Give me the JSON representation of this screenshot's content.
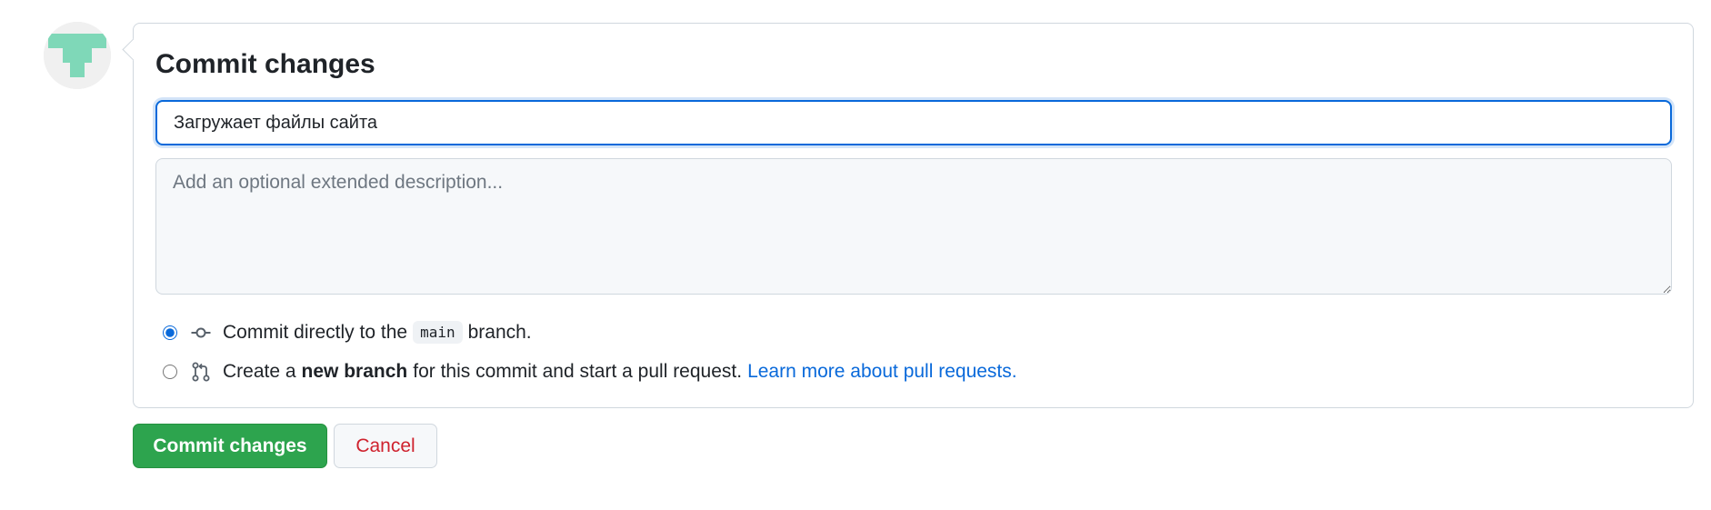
{
  "avatar": {
    "icon": "identicon-avatar",
    "color": "#7fd8b8"
  },
  "form": {
    "title": "Commit changes",
    "summary_value": "Загружает файлы сайта",
    "description_placeholder": "Add an optional extended description..."
  },
  "options": {
    "direct": {
      "selected": true,
      "icon": "git-commit-icon",
      "prefix": "Commit directly to the",
      "branch": "main",
      "suffix": "branch."
    },
    "new_branch": {
      "selected": false,
      "icon": "git-pull-request-icon",
      "prefix": "Create a",
      "bold": "new branch",
      "suffix": "for this commit and start a pull request.",
      "link": "Learn more about pull requests."
    }
  },
  "buttons": {
    "commit": "Commit changes",
    "cancel": "Cancel"
  },
  "colors": {
    "primary_green": "#2da44e",
    "link_blue": "#0969da",
    "danger_red": "#cf222e"
  }
}
